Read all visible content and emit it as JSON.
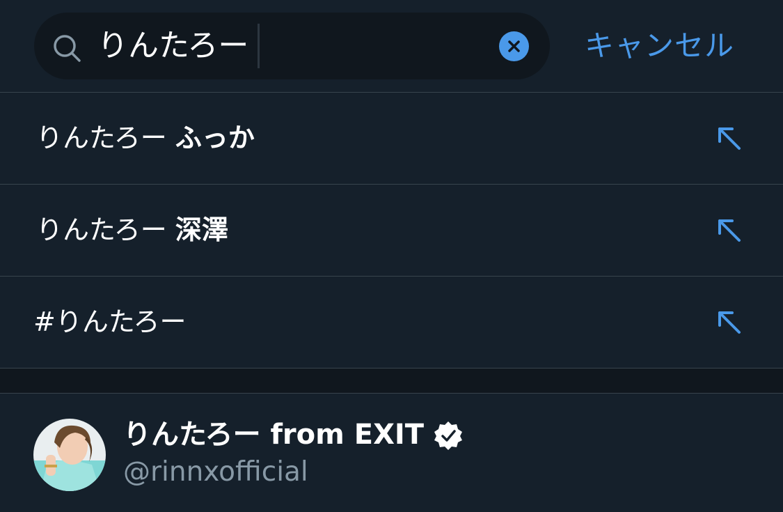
{
  "search": {
    "value": "りんたろー",
    "cancel_label": "キャンセル"
  },
  "suggestions": [
    {
      "prefix": "りんたろー ",
      "bold": "ふっか"
    },
    {
      "prefix": "りんたろー ",
      "bold": "深澤"
    },
    {
      "prefix": "#りんたろー",
      "bold": ""
    }
  ],
  "user": {
    "name": "りんたろー from EXIT",
    "handle": "@rinnxofficial",
    "verified": true
  },
  "colors": {
    "background": "#15202b",
    "accent": "#4a99e9",
    "secondary_text": "#8899a6",
    "divider": "#38444d"
  },
  "icons": {
    "search": "search-icon",
    "clear": "clear-icon",
    "suggestion_arrow": "arrow-up-left-icon",
    "verified": "verified-badge-icon"
  }
}
